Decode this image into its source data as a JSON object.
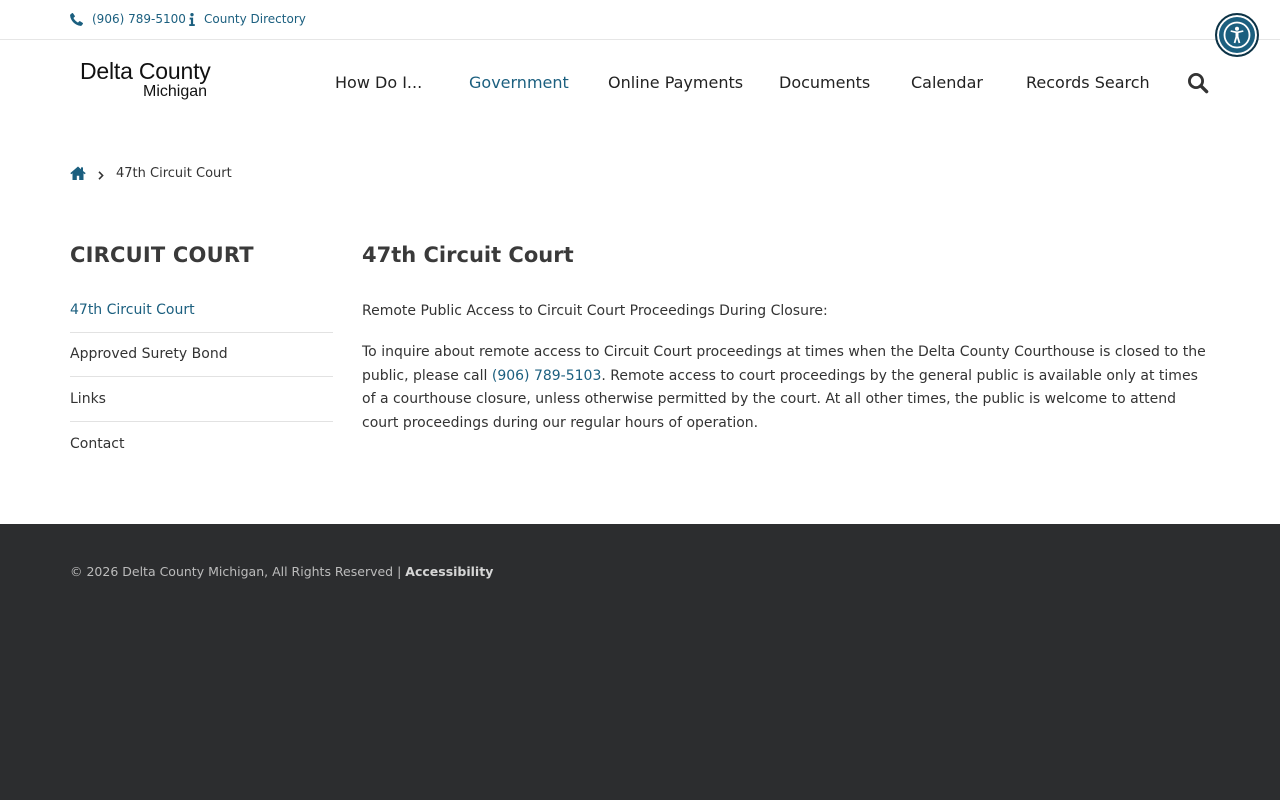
{
  "topbar": {
    "phone": "(906) 789-5100",
    "directory": "County Directory",
    "phone_icon": "phone-icon",
    "info_icon": "info-icon"
  },
  "accessibility_widget": {
    "icon": "accessibility-person-icon",
    "color": "#1b5f7f"
  },
  "logo": {
    "line1": "Delta County",
    "line2": "Michigan"
  },
  "nav": {
    "items": [
      {
        "label": "How Do I..."
      },
      {
        "label": "Government",
        "active": true
      },
      {
        "label": "Online Payments"
      },
      {
        "label": "Documents"
      },
      {
        "label": "Calendar"
      },
      {
        "label": "Records Search"
      }
    ],
    "search_icon": "search-icon"
  },
  "breadcrumb": {
    "home_icon": "home-icon",
    "separator_icon": "chevron-right-icon",
    "current": "47th Circuit Court"
  },
  "sidebar": {
    "title": "CIRCUIT COURT",
    "items": [
      {
        "label": "47th Circuit Court",
        "active": true
      },
      {
        "label": "Approved Surety Bond"
      },
      {
        "label": "Links"
      },
      {
        "label": "Contact"
      }
    ]
  },
  "main": {
    "title": "47th Circuit Court",
    "p1": "Remote Public Access to Circuit Court Proceedings During Closure:",
    "p2_before": "To inquire about remote access to Circuit Court proceedings at times when the Delta County Courthouse is closed to the public, please call ",
    "p2_phone": "(906) 789-5103",
    "p2_after": ". Remote access to court proceedings by the general public is available only at times of a courthouse closure, unless otherwise permitted by the court.  At all other times, the public is welcome to attend court proceedings during our regular hours of operation."
  },
  "footer": {
    "copyright": "© 2026 Delta County Michigan, All Rights Reserved | ",
    "accessibility": "Accessibility"
  },
  "colors": {
    "accent": "#1b5f7f",
    "footer_bg": "#2c2d2f",
    "text": "#333333"
  }
}
